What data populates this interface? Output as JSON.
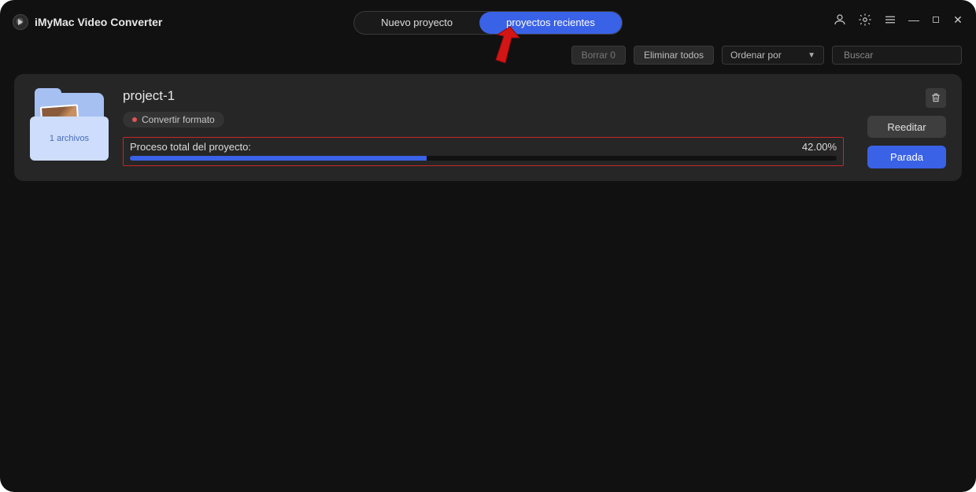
{
  "app": {
    "title": "iMyMac Video Converter"
  },
  "tabs": {
    "new_project": "Nuevo proyecto",
    "recent_projects": "proyectos recientes",
    "active": "recent_projects"
  },
  "toolbar": {
    "delete_count_label": "Borrar 0",
    "delete_all_label": "Eliminar todos",
    "sort_label": "Ordenar por",
    "search_placeholder": "Buscar"
  },
  "project": {
    "name": "project-1",
    "file_count_label": "1 archivos",
    "badge_label": "Convertir formato",
    "progress_label": "Proceso total del proyecto:",
    "progress_percent_text": "42.00%",
    "progress_percent_value": 42,
    "actions": {
      "reedit": "Reeditar",
      "stop": "Parada"
    }
  },
  "colors": {
    "accent": "#3a62e6",
    "highlight_border": "#c62828",
    "card_bg": "#262626"
  }
}
